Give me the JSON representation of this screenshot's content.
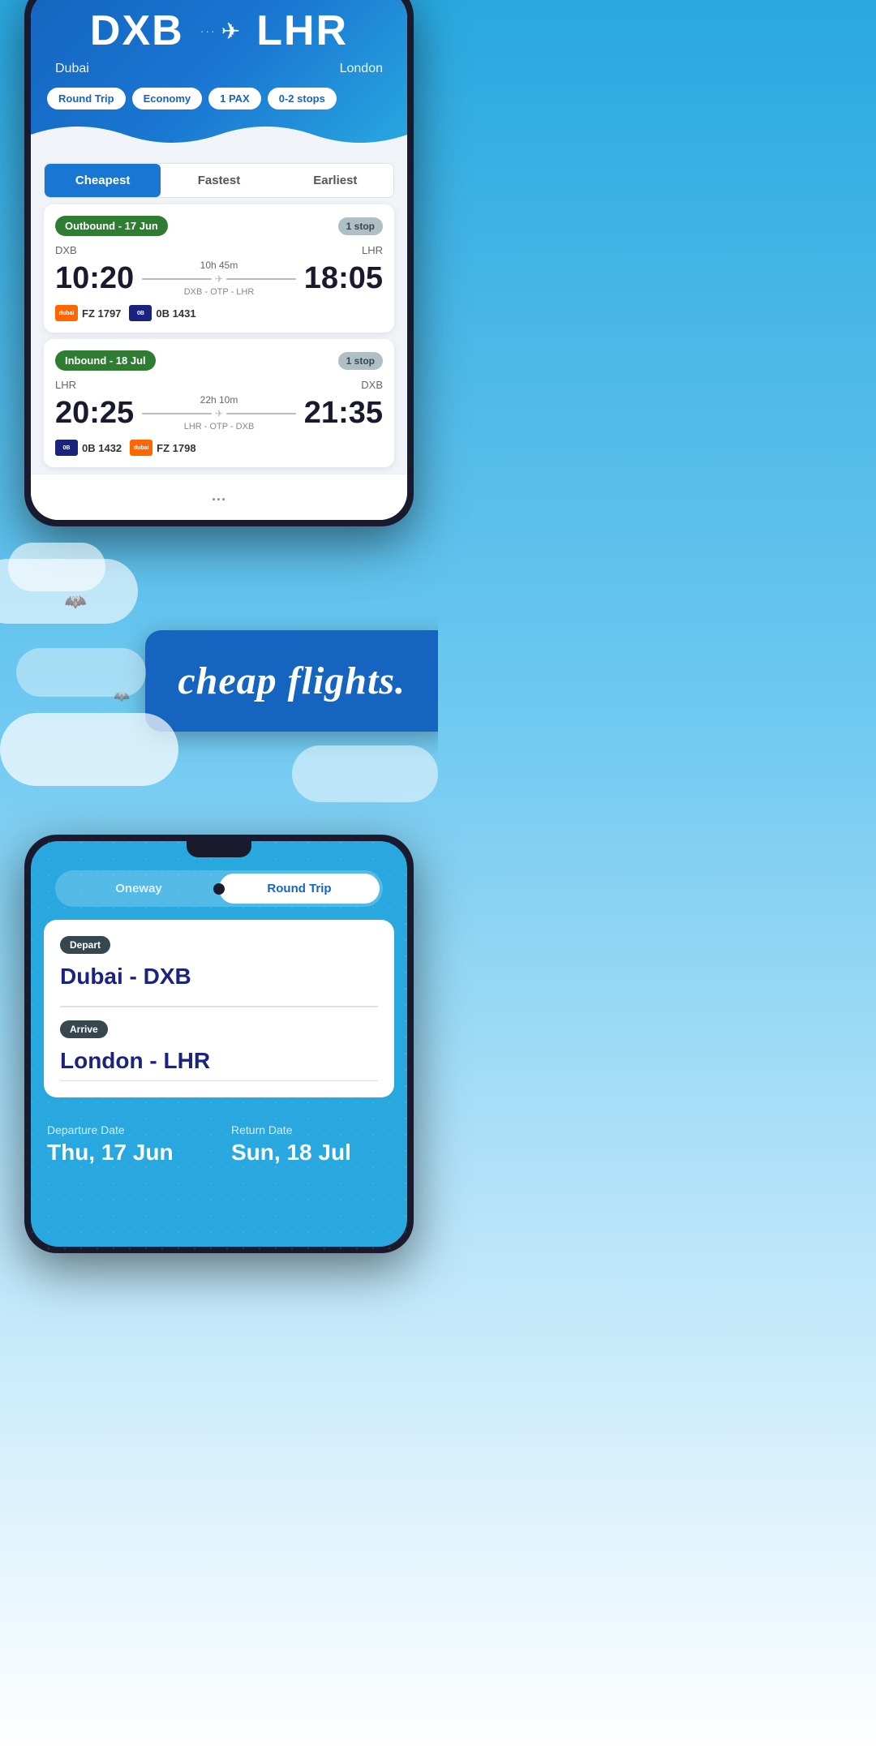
{
  "phone1": {
    "header": {
      "origin_code": "DXB",
      "origin_city": "Dubai",
      "dest_code": "LHR",
      "dest_city": "London",
      "pill_trip": "Round Trip",
      "pill_class": "Economy",
      "pill_pax": "1 PAX",
      "pill_stops": "0-2 stops"
    },
    "tabs": [
      {
        "label": "Cheapest",
        "active": true
      },
      {
        "label": "Fastest",
        "active": false
      },
      {
        "label": "Earliest",
        "active": false
      }
    ],
    "flights": [
      {
        "direction_label": "Outbound - 17 Jun",
        "stops_label": "1 stop",
        "origin": "DXB",
        "destination": "LHR",
        "depart_time": "10:20",
        "arrive_time": "18:05",
        "duration": "10h 45m",
        "via": "DXB - OTP - LHR",
        "airlines": [
          {
            "logo_class": "logo-dubai",
            "logo_text": "dubai",
            "flight_no": "FZ 1797"
          },
          {
            "logo_class": "logo-blue",
            "logo_text": "0B",
            "flight_no": "0B 1431"
          }
        ]
      },
      {
        "direction_label": "Inbound - 18 Jul",
        "stops_label": "1 stop",
        "origin": "LHR",
        "destination": "DXB",
        "depart_time": "20:25",
        "arrive_time": "21:35",
        "duration": "22h 10m",
        "via": "LHR - OTP - DXB",
        "airlines": [
          {
            "logo_class": "logo-blue",
            "logo_text": "0B",
            "flight_no": "0B 1432"
          },
          {
            "logo_class": "logo-dubai",
            "logo_text": "dubai",
            "flight_no": "FZ 1798"
          }
        ]
      }
    ]
  },
  "middle": {
    "tagline": "cheap flights."
  },
  "phone2": {
    "trip_options": [
      {
        "label": "Oneway",
        "active": false
      },
      {
        "label": "Round Trip",
        "active": true
      }
    ],
    "depart_label": "Depart",
    "depart_value": "Dubai - DXB",
    "arrive_label": "Arrive",
    "arrive_value": "London - LHR",
    "departure_date_label": "Departure Date",
    "departure_date_value": "Thu, 17 Jun",
    "return_date_label": "Return Date",
    "return_date_value": "Sun, 18 Jul"
  }
}
